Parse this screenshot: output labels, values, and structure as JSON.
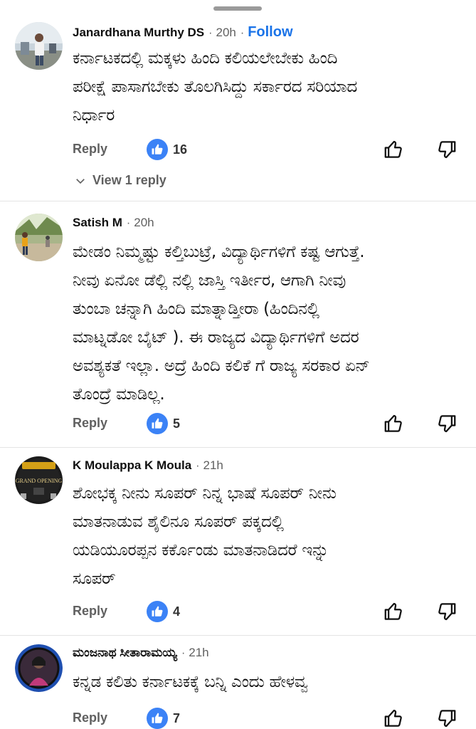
{
  "comments": [
    {
      "author": "Janardhana Murthy DS",
      "time": "20h",
      "follow_label": "Follow",
      "text": "ಕರ್ನಾಟಕದಲ್ಲಿ ಮಕ್ಕಳು ಹಿಂದಿ ಕಲಿಯಲೇಬೇಕು ಹಿಂದಿ\nಪರೀಕ್ಷೆ ಪಾಸಾಗಬೇಕು ತೊಲಗಿಸಿದ್ದು ಸರ್ಕಾರದ ಸರಿಯಾದ\nನಿರ್ಧಾರ",
      "reply_label": "Reply",
      "likes": "16",
      "view_replies_label": "View 1 reply"
    },
    {
      "author": "Satish M",
      "time": "20h",
      "text": "ಮೇಡಂ ನಿಮ್ಮಷ್ಟು ಕಲ್ತಿಬುಟ್ರೆ, ವಿದ್ಯಾರ್ಥಿಗಳಿಗೆ ಕಷ್ಟ ಆಗುತ್ತೆ.\nನೀವು ಏನೋ ಡೆಲ್ಲಿ ನಲ್ಲಿ ಜಾಸ್ತಿ ಇರ್ತೀರ, ಆಗಾಗಿ ನೀವು\nತುಂಬಾ ಚನ್ನಾಗಿ ಹಿಂದಿ ಮಾತ್ನಾಡ್ತೀರಾ (ಹಿಂದಿನಲ್ಲಿ\nಮಾಟ್ನಡೋ ಬೈಟ್ ). ಈ ರಾಜ್ಯದ ವಿದ್ಯಾರ್ಥಿಗಳಿಗೆ ಅದರ\nಅವಶ್ಯಕತೆ ಇಲ್ಲಾ. ಅದ್ರೆ ಹಿಂದಿ ಕಲಿಕೆ ಗೆ ರಾಜ್ಯ ಸರಕಾರ ಏನ್\nತೊಂದ್ರೆ ಮಾಡಿಲ್ಲ.",
      "reply_label": "Reply",
      "likes": "5"
    },
    {
      "author": "K Moulappa K Moula",
      "time": "21h",
      "avatar_text": "GRAND OPENING",
      "text": "ಶೋಭಕ್ಕ ನೀನು ಸೂಪರ್ ನಿನ್ನ ಭಾಷೆ ಸೂಪರ್ ನೀನು\nಮಾತನಾಡುವ ಶೈಲಿನೂ ಸೂಪರ್ ಪಕ್ಕದಲ್ಲಿ\nಯಡಿಯೂರಪ್ಪನ ಕರ್ಕೊಂಡು ಮಾತನಾಡಿದರೆ ಇನ್ನು\nಸೂಪರ್",
      "reply_label": "Reply",
      "likes": "4"
    },
    {
      "author": "ಮಂಜನಾಥ ಸೀತಾರಾಮಯ್ಯ",
      "time": "21h",
      "text": "ಕನ್ನಡ ಕಲಿತು ಕರ್ನಾಟಕಕ್ಕೆ ಬನ್ನಿ ಎಂದು ಹೇಳವ್ವ",
      "reply_label": "Reply",
      "likes": "7"
    }
  ],
  "colors": {
    "accent": "#1a73e8",
    "like_badge": "#3b82f6",
    "secondary_text": "#606060"
  },
  "icons": [
    "thumbs-up-icon",
    "thumbs-down-icon",
    "chevron-down-icon",
    "like-reaction-icon"
  ]
}
